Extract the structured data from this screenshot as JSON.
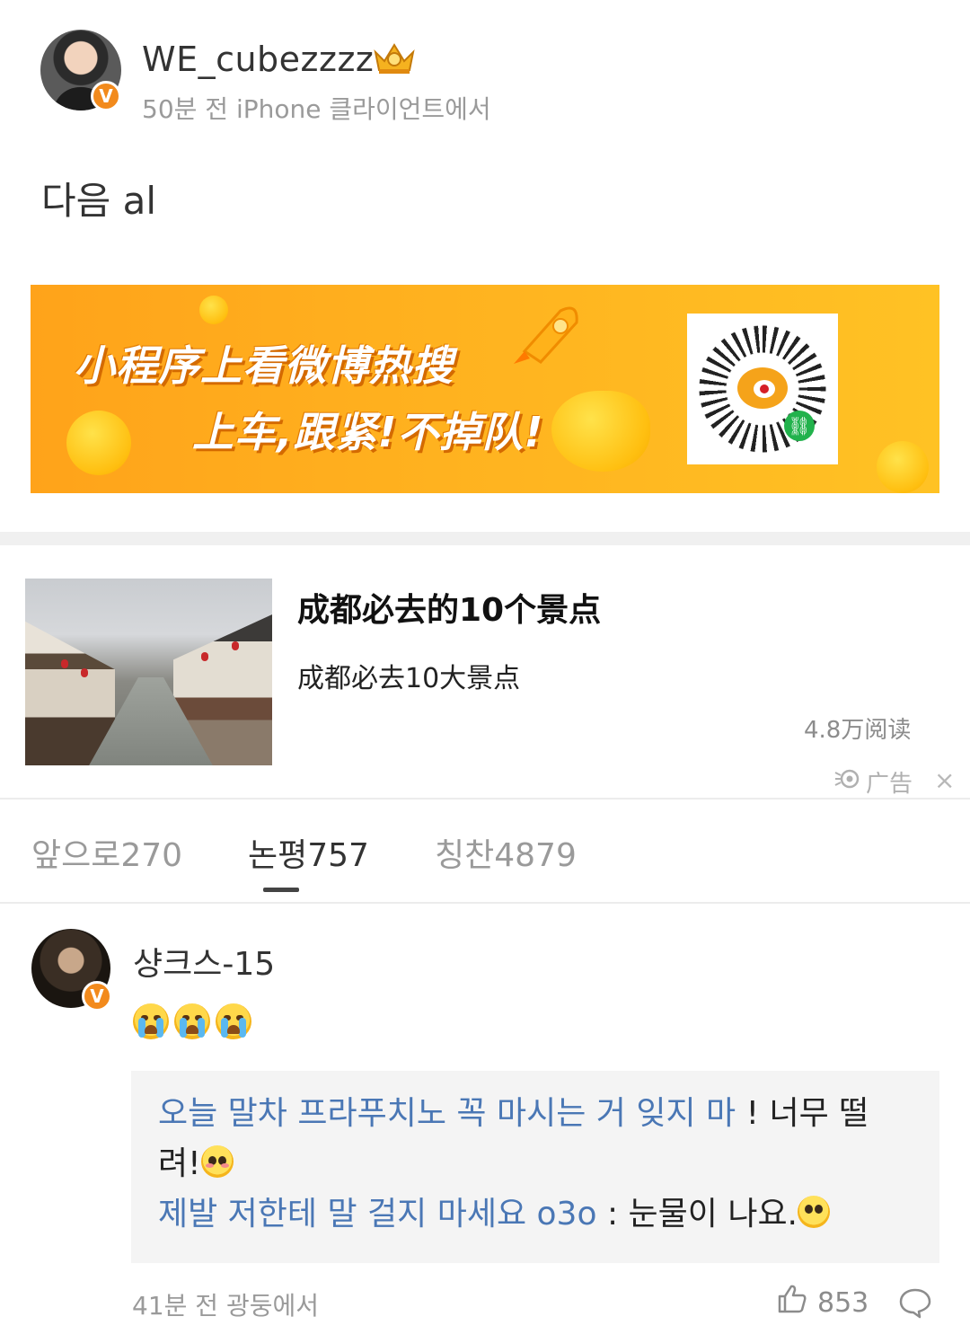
{
  "post": {
    "username": "WE_cubezzzz",
    "meta": "50분 전 iPhone 클라이언트에서",
    "text": "다음 al",
    "icons": [
      "avatar",
      "verified-badge-icon",
      "crown-badge-icon"
    ]
  },
  "banner_ad": {
    "line1": "小程序上看微博热搜",
    "line2": "上车,跟紧!不掉队!",
    "colors": {
      "background": "#ffad1d",
      "text": "#ffffff"
    },
    "icons": [
      "rocket-icon",
      "weibo-logo-icon",
      "qr-code-icon",
      "mini-program-icon"
    ]
  },
  "article_ad": {
    "title": "成都必去的10个景点",
    "subtitle": "成都必去10大景点",
    "reads": "4.8万阅读",
    "ad_label": "广告",
    "close": "×"
  },
  "tabs": [
    {
      "label": "앞으로270",
      "active": false
    },
    {
      "label": "논평757",
      "active": true
    },
    {
      "label": "칭찬4879",
      "active": false
    }
  ],
  "comment": {
    "username": "샹크스-15",
    "emojis": [
      "crying-face-icon",
      "crying-face-icon",
      "crying-face-icon"
    ],
    "replies": [
      {
        "author": "오늘 말차 프라푸치노 꼭 마시는 거 잊지 마",
        "sep": " ! ",
        "text_a": "너무 떨",
        "text_b": "려!"
      },
      {
        "author": "제발 저한테 말 걸지 마세요 o3o",
        "sep": " : ",
        "text": "눈물이 나요."
      }
    ],
    "time": "41분 전 광둥에서",
    "likes": "853",
    "colors": {
      "link": "#4a77b5",
      "reply_bg": "#f4f4f4"
    }
  }
}
